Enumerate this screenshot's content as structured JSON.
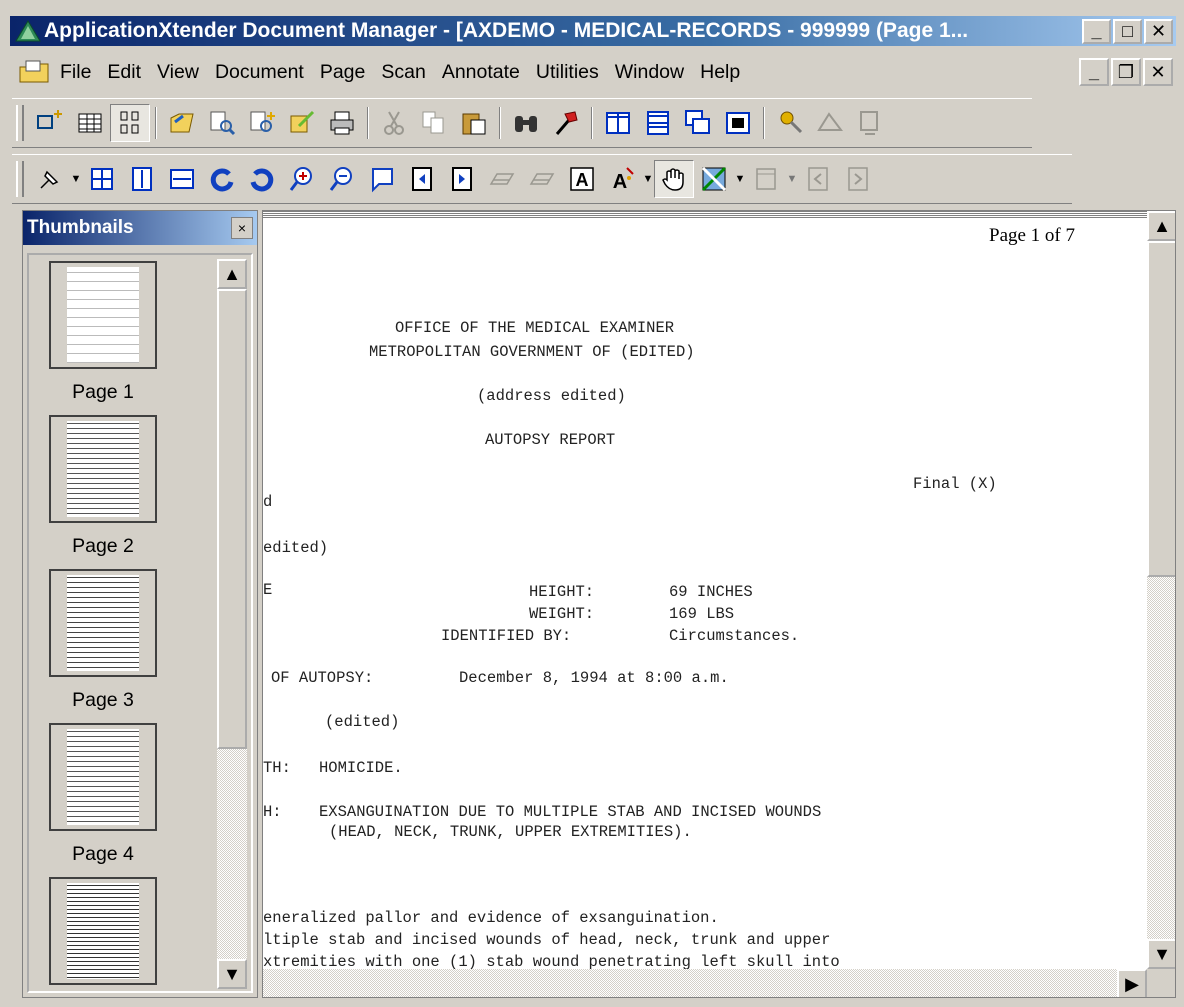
{
  "window": {
    "title": "ApplicationXtender Document Manager - [AXDEMO - MEDICAL-RECORDS - 999999 (Page 1...",
    "buttons": {
      "minimize": "_",
      "maximize": "□",
      "close": "✕"
    }
  },
  "menu": {
    "items": [
      "File",
      "Edit",
      "View",
      "Document",
      "Page",
      "Scan",
      "Annotate",
      "Utilities",
      "Window",
      "Help"
    ],
    "mdi_buttons": {
      "minimize": "_",
      "restore": "❐",
      "close": "✕"
    }
  },
  "toolbar1": {
    "icons": [
      "new-document-icon",
      "list-view-icon",
      "thumbnail-view-icon",
      "open-folder-icon",
      "search-document-icon",
      "new-query-icon",
      "edit-document-icon",
      "print-icon",
      "cut-icon",
      "copy-icon",
      "paste-icon",
      "find-icon",
      "hammer-icon",
      "tile-vertical-icon",
      "tile-horizontal-icon",
      "cascade-icon",
      "full-window-icon",
      "keys-icon",
      "erase-icon",
      "properties-icon"
    ]
  },
  "toolbar2": {
    "icons": [
      "pin-icon",
      "fit-page-icon",
      "fit-height-icon",
      "fit-width-icon",
      "rotate-left-icon",
      "rotate-right-icon",
      "zoom-in-icon",
      "zoom-out-icon",
      "select-area-icon",
      "previous-page-icon",
      "next-page-icon",
      "fit-best-icon",
      "fit-all-icon",
      "text-annotation-icon",
      "highlight-icon",
      "hand-pan-icon",
      "image-enhance-icon",
      "layout-icon",
      "first-page-icon",
      "last-page-icon"
    ]
  },
  "thumbnails": {
    "title": "Thumbnails",
    "close": "×",
    "pages": [
      {
        "label": "Page 1"
      },
      {
        "label": "Page 2"
      },
      {
        "label": "Page 3"
      },
      {
        "label": "Page 4"
      },
      {
        "label": ""
      }
    ]
  },
  "document": {
    "page_indicator": "Page 1 of 7",
    "lines": [
      "OFFICE OF THE MEDICAL EXAMINER",
      "METROPOLITAN GOVERNMENT OF (EDITED)",
      "(address edited)",
      "AUTOPSY REPORT",
      "Final (X)",
      "d",
      "edited)",
      "E",
      "HEIGHT:",
      "69 INCHES",
      "WEIGHT:",
      "169 LBS",
      "IDENTIFIED BY:",
      "Circumstances.",
      "OF AUTOPSY:",
      "December 8, 1994 at 8:00 a.m.",
      "(edited)",
      "TH:",
      "HOMICIDE.",
      "H:",
      "EXSANGUINATION DUE TO MULTIPLE STAB AND INCISED WOUNDS",
      "(HEAD, NECK, TRUNK, UPPER EXTREMITIES).",
      "eneralized pallor and evidence of exsanguination.",
      "ltiple stab and incised wounds of head, neck, trunk and upper",
      "xtremities with one (1) stab wound penetrating left skull into"
    ]
  },
  "colors": {
    "titlebar_start": "#0a246a",
    "titlebar_end": "#a6caf0",
    "chrome": "#d4d0c8"
  }
}
